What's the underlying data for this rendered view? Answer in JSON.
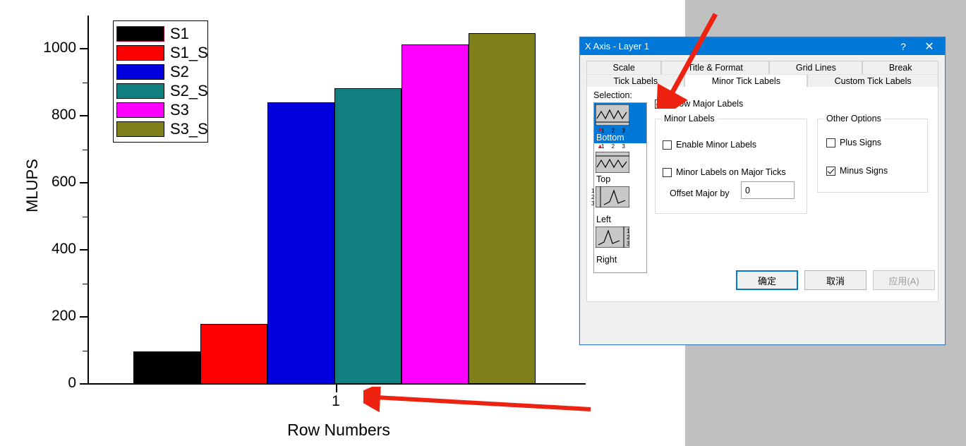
{
  "chart_data": {
    "type": "bar",
    "title": "",
    "xlabel": "Row Numbers",
    "ylabel": "MLUPS",
    "categories": [
      "1"
    ],
    "xtick_labels": [
      "1"
    ],
    "ylim": [
      0,
      1100
    ],
    "yticks": [
      0,
      200,
      400,
      600,
      800,
      1000
    ],
    "ytick_labels": [
      "0",
      "200",
      "400",
      "600",
      "800",
      "1000"
    ],
    "grid": false,
    "legend_position": "upper-left",
    "series": [
      {
        "name": "S1",
        "color": "#000000",
        "values": [
          97
        ]
      },
      {
        "name": "S1_S",
        "color": "#ff0000",
        "values": [
          180
        ]
      },
      {
        "name": "S2",
        "color": "#0000dd",
        "values": [
          840
        ]
      },
      {
        "name": "S2_S",
        "color": "#117f7f",
        "values": [
          884
        ]
      },
      {
        "name": "S3",
        "color": "#ff00ff",
        "values": [
          1013
        ]
      },
      {
        "name": "S3_S",
        "color": "#80801a",
        "values": [
          1048
        ]
      }
    ]
  },
  "dialog": {
    "title": "X Axis - Layer 1",
    "help_icon": "?",
    "close_icon": "✕",
    "tabs_row1": [
      {
        "label": "Scale",
        "active": false
      },
      {
        "label": "Title & Format",
        "active": false
      },
      {
        "label": "Grid Lines",
        "active": false
      },
      {
        "label": "Break",
        "active": false
      }
    ],
    "tabs_row2": [
      {
        "label": "Tick Labels",
        "active": false
      },
      {
        "label": "Minor Tick Labels",
        "active": true
      },
      {
        "label": "Custom Tick Labels",
        "active": false
      }
    ],
    "selection": {
      "label": "Selection:",
      "items": [
        {
          "label": "Bottom",
          "selected": true
        },
        {
          "label": "Top",
          "selected": false
        },
        {
          "label": "Left",
          "selected": false
        },
        {
          "label": "Right",
          "selected": false
        }
      ]
    },
    "show_major_labels": {
      "label": "Show Major Labels",
      "checked": true
    },
    "minor_labels_group": {
      "title": "Minor Labels",
      "enable_minor_labels": {
        "label": "Enable Minor Labels",
        "checked": false
      },
      "minor_labels_on_major_ticks": {
        "label": "Minor Labels on Major Ticks",
        "checked": false
      },
      "offset_major_by": {
        "label": "Offset Major by",
        "value": "0"
      }
    },
    "other_options_group": {
      "title": "Other Options",
      "plus_signs": {
        "label": "Plus Signs",
        "checked": false
      },
      "minus_signs": {
        "label": "Minus Signs",
        "checked": true
      }
    },
    "buttons": [
      {
        "label": "确定",
        "state": "default"
      },
      {
        "label": "取消",
        "state": "normal"
      },
      {
        "label": "应用(A)",
        "state": "disabled"
      }
    ]
  },
  "colors": {
    "titlebar": "#0078d7",
    "dialog_bg": "#f0f0f0",
    "annotation": "#ee2211"
  }
}
